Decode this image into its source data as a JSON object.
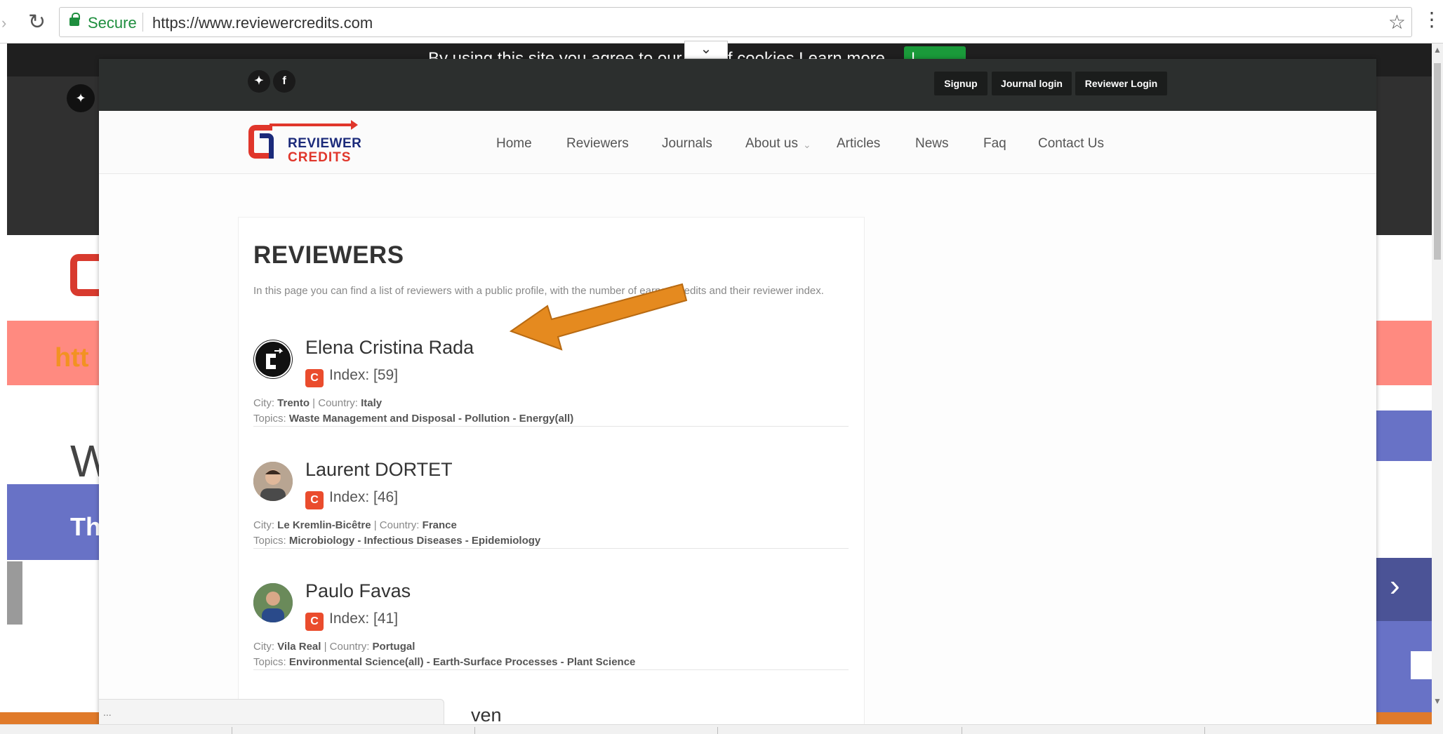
{
  "browser": {
    "secure_label": "Secure",
    "url": "https://www.reviewercredits.com"
  },
  "background_page": {
    "cookie_text": "By using this site you agree to our use of cookies   Learn more",
    "cookie_button": "I agree",
    "hero_text": "htt",
    "welcome_initial": "W",
    "blue_text": "Th"
  },
  "overlay": {
    "topbar_buttons": [
      "Signup",
      "Journal login",
      "Reviewer Login"
    ],
    "logo": {
      "line1": "REVIEWER",
      "line2": "CREDITS"
    },
    "nav": [
      "Home",
      "Reviewers",
      "Journals",
      "About us",
      "Articles",
      "News",
      "Faq",
      "Contact Us"
    ],
    "page_title": "REVIEWERS",
    "intro": "In this page you can find a list of reviewers with a public profile, with the number of earned credits and their reviewer index.",
    "city_label": "City:",
    "country_label": "Country:",
    "topics_label": "Topics:",
    "reviewers": [
      {
        "name": "Elena Cristina Rada",
        "index": "Index: [59]",
        "city": "Trento",
        "country": "Italy",
        "topics": "Waste Management and Disposal - Pollution - Energy(all)"
      },
      {
        "name": "Laurent DORTET",
        "index": "Index: [46]",
        "city": "Le Kremlin-Bicêtre",
        "country": "France",
        "topics": "Microbiology - Infectious Diseases - Epidemiology"
      },
      {
        "name": "Paulo Favas",
        "index": "Index: [41]",
        "city": "Vila Real",
        "country": "Portugal",
        "topics": "Environmental Science(all) - Earth-Surface Processes - Plant Science"
      }
    ],
    "next_name_peek": "ven",
    "status_text": "..."
  },
  "colors": {
    "accent_orange": "#e58a1f",
    "brand_red": "#e0362b",
    "brand_navy": "#1b2a7a",
    "topbar_dark": "#2c2f2e"
  }
}
